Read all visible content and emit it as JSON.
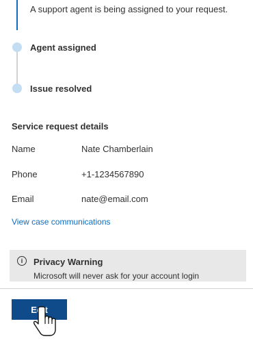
{
  "timeline": {
    "current_status": "A support agent is being assigned to your request.",
    "steps": [
      {
        "label": "Agent assigned"
      },
      {
        "label": "Issue resolved"
      }
    ]
  },
  "details": {
    "title": "Service request details",
    "rows": [
      {
        "label": "Name",
        "value": "Nate Chamberlain"
      },
      {
        "label": "Phone",
        "value": "+1-1234567890"
      },
      {
        "label": "Email",
        "value": "nate@email.com"
      }
    ],
    "link": "View case communications"
  },
  "privacy": {
    "icon": "info-icon",
    "icon_glyph": "i",
    "title": "Privacy Warning",
    "text": "Microsoft will never ask for your account login"
  },
  "actions": {
    "edit_label": "Edit"
  },
  "colors": {
    "accent": "#0f6cbd",
    "button": "#0f4a8a",
    "dot": "#c3ddf3",
    "warning_bg": "#e8e8e8"
  }
}
